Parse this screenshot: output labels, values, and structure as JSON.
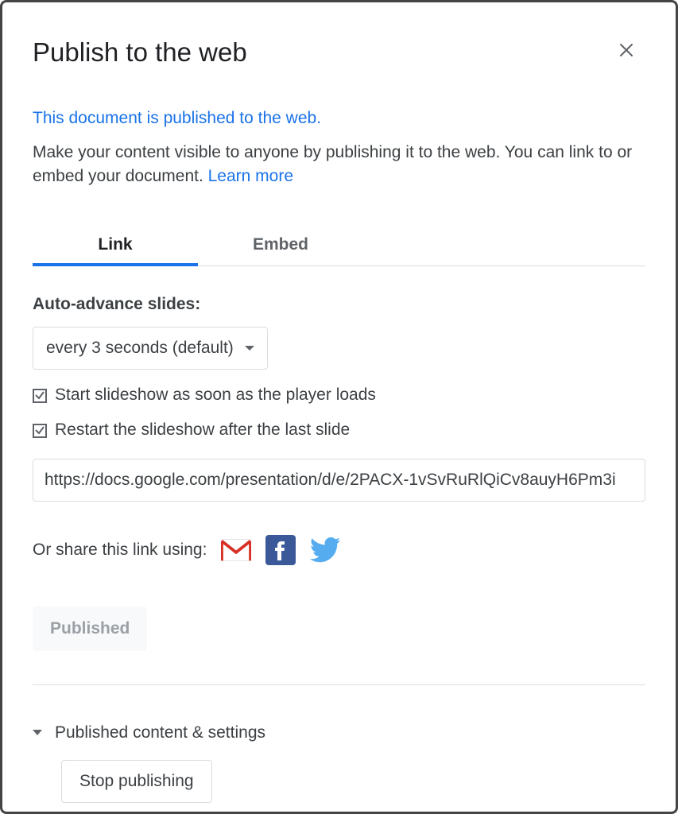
{
  "dialog": {
    "title": "Publish to the web",
    "status_text": "This document is published to the web.",
    "description": "Make your content visible to anyone by publishing it to the web. You can link to or embed your document. ",
    "learn_more": "Learn more"
  },
  "tabs": {
    "link": "Link",
    "embed": "Embed",
    "active": "link"
  },
  "auto_advance": {
    "label": "Auto-advance slides:",
    "value": "every 3 seconds (default)"
  },
  "checkboxes": {
    "start_on_load": {
      "label": "Start slideshow as soon as the player loads",
      "checked": true
    },
    "restart_after_last": {
      "label": "Restart the slideshow after the last slide",
      "checked": true
    }
  },
  "url": {
    "value": "https://docs.google.com/presentation/d/e/2PACX-1vSvRuRlQiCv8auyH6Pm3i"
  },
  "share": {
    "label": "Or share this link using:"
  },
  "published_button": "Published",
  "expand": {
    "label": "Published content & settings"
  },
  "stop_button": "Stop publishing"
}
